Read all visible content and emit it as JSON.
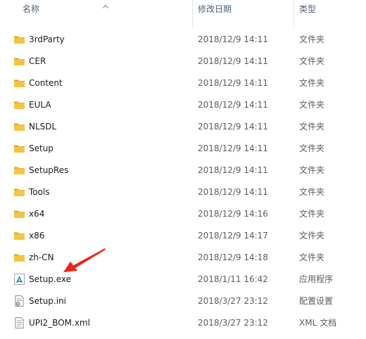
{
  "header": {
    "name_label": "名称",
    "date_label": "修改日期",
    "type_label": "类型"
  },
  "colors": {
    "folder": "#f5c443",
    "header_text": "#4c607a",
    "annotation_arrow": "#e8261c"
  },
  "files": [
    {
      "name": "3rdParty",
      "date": "2018/12/9 14:11",
      "type": "文件夹",
      "icon": "folder-icon"
    },
    {
      "name": "CER",
      "date": "2018/12/9 14:11",
      "type": "文件夹",
      "icon": "folder-icon"
    },
    {
      "name": "Content",
      "date": "2018/12/9 14:11",
      "type": "文件夹",
      "icon": "folder-icon"
    },
    {
      "name": "EULA",
      "date": "2018/12/9 14:11",
      "type": "文件夹",
      "icon": "folder-icon"
    },
    {
      "name": "NLSDL",
      "date": "2018/12/9 14:11",
      "type": "文件夹",
      "icon": "folder-icon"
    },
    {
      "name": "Setup",
      "date": "2018/12/9 14:11",
      "type": "文件夹",
      "icon": "folder-icon"
    },
    {
      "name": "SetupRes",
      "date": "2018/12/9 14:11",
      "type": "文件夹",
      "icon": "folder-icon"
    },
    {
      "name": "Tools",
      "date": "2018/12/9 14:11",
      "type": "文件夹",
      "icon": "folder-icon"
    },
    {
      "name": "x64",
      "date": "2018/12/9 14:16",
      "type": "文件夹",
      "icon": "folder-icon"
    },
    {
      "name": "x86",
      "date": "2018/12/9 14:17",
      "type": "文件夹",
      "icon": "folder-icon"
    },
    {
      "name": "zh-CN",
      "date": "2018/12/9 14:18",
      "type": "文件夹",
      "icon": "folder-icon"
    },
    {
      "name": "Setup.exe",
      "date": "2018/1/11 16:42",
      "type": "应用程序",
      "icon": "setup-app-icon"
    },
    {
      "name": "Setup.ini",
      "date": "2018/3/27 23:12",
      "type": "配置设置",
      "icon": "config-file-icon"
    },
    {
      "name": "UPI2_BOM.xml",
      "date": "2018/3/27 23:12",
      "type": "XML 文档",
      "icon": "xml-file-icon"
    }
  ]
}
